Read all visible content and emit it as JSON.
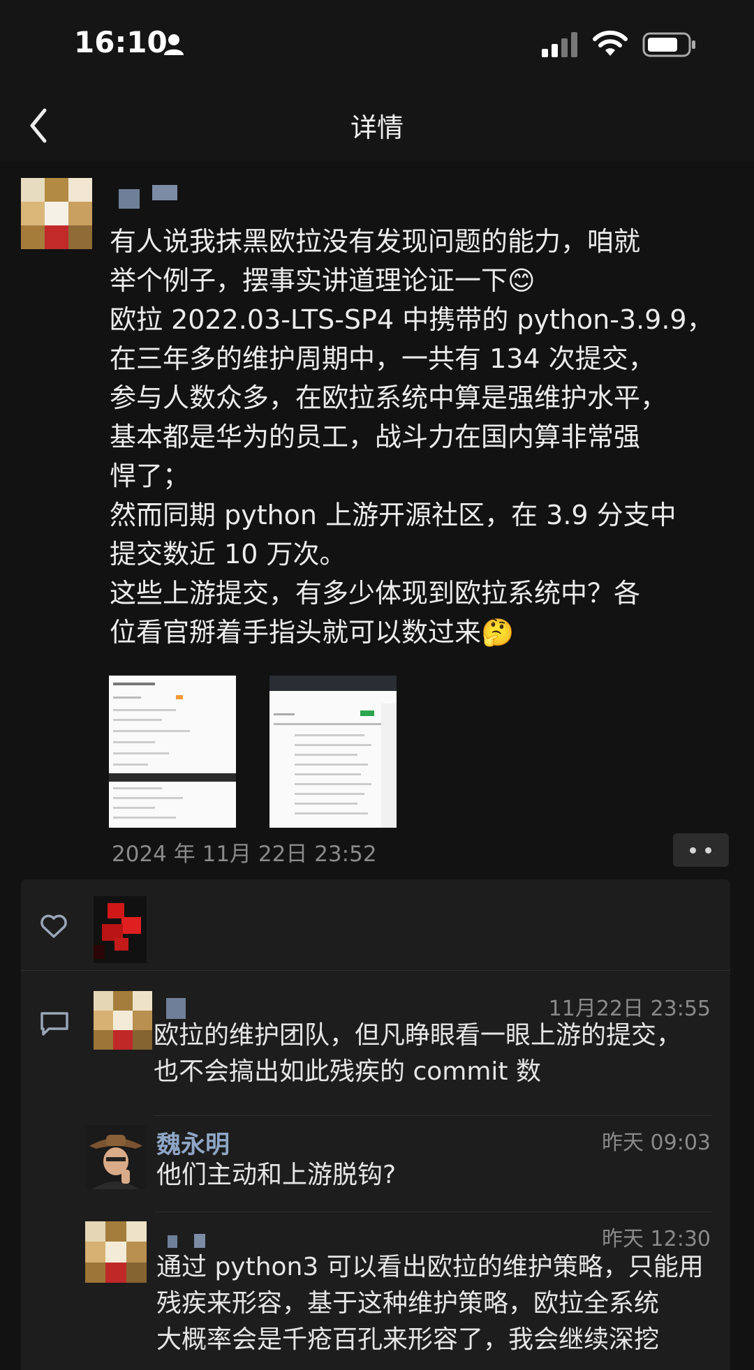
{
  "status_bar": {
    "time": "16:10"
  },
  "nav": {
    "title": "详情"
  },
  "post": {
    "text": "有人说我抹黑欧拉没有发现问题的能力，咱就\n举个例子，摆事实讲道理论证一下😊\n欧拉 2022.03-LTS-SP4 中携带的 python-3.9.9，\n在三年多的维护周期中，一共有 134 次提交，\n参与人数众多，在欧拉系统中算是强维护水平，\n基本都是华为的员工，战斗力在国内算非常强\n悍了；\n然而同期 python 上游开源社区，在 3.9 分支中\n提交数近 10 万次。\n这些上游提交，有多少体现到欧拉系统中？各\n位看官掰着手指头就可以数过来🤔",
    "date": "2024 年 11月 22日  23:52"
  },
  "comments": [
    {
      "name": "",
      "time": "11月22日 23:55",
      "text": "欧拉的维护团队，但凡睁眼看一眼上游的提交，\n也不会搞出如此残疾的 commit 数"
    },
    {
      "name": "魏永明",
      "time": "昨天 09:03",
      "text": "他们主动和上游脱钩?"
    },
    {
      "name": "",
      "time": "昨天 12:30",
      "text": "通过 python3 可以看出欧拉的维护策略，只能用\n残疾来形容，基于这种维护策略，欧拉全系统\n大概率会是千疮百孔来形容了，我会继续深挖"
    }
  ]
}
